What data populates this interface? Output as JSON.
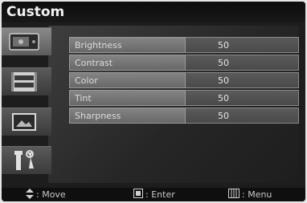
{
  "title": "Custom",
  "settings": [
    {
      "label": "Brightness",
      "value": "50"
    },
    {
      "label": "Contrast",
      "value": "50"
    },
    {
      "label": "Color",
      "value": "50"
    },
    {
      "label": "Tint",
      "value": "50"
    },
    {
      "label": "Sharpness",
      "value": "50"
    }
  ],
  "sidebar": {
    "items": [
      {
        "icon": "picture-input-icon"
      },
      {
        "icon": "film-strip-icon"
      },
      {
        "icon": "photo-icon"
      },
      {
        "icon": "tools-icon"
      }
    ]
  },
  "footer": {
    "move": ": Move",
    "enter": ": Enter",
    "menu": ": Menu"
  }
}
